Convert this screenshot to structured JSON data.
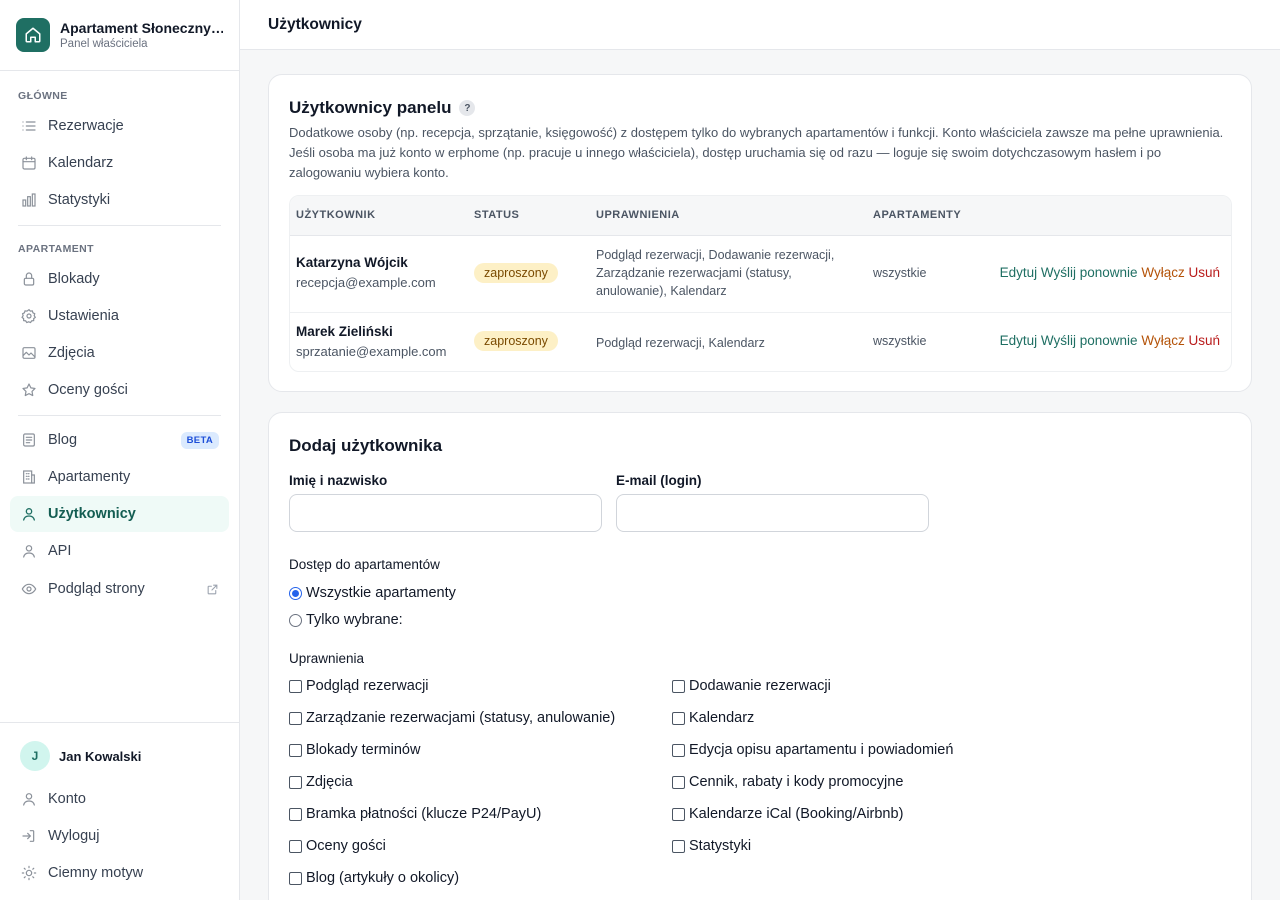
{
  "brand": {
    "title": "Apartament Słoneczny…",
    "subtitle": "Panel właściciela"
  },
  "sidebar": {
    "section_main": "GŁÓWNE",
    "section_apartment": "APARTAMENT",
    "items": [
      {
        "label": "Rezerwacje",
        "icon": "list-icon"
      },
      {
        "label": "Kalendarz",
        "icon": "calendar-icon"
      },
      {
        "label": "Statystyki",
        "icon": "bar-chart-icon"
      },
      {
        "label": "Blokady",
        "icon": "lock-icon"
      },
      {
        "label": "Ustawienia",
        "icon": "gear-icon"
      },
      {
        "label": "Zdjęcia",
        "icon": "image-icon"
      },
      {
        "label": "Oceny gości",
        "icon": "star-icon"
      },
      {
        "label": "Blog",
        "icon": "document-icon",
        "badge": "BETA"
      },
      {
        "label": "Apartamenty",
        "icon": "building-icon"
      },
      {
        "label": "Użytkownicy",
        "icon": "user-icon",
        "active": true
      },
      {
        "label": "API",
        "icon": "user-icon"
      },
      {
        "label": "Podgląd strony",
        "icon": "eye-icon"
      }
    ],
    "user": {
      "initial": "J",
      "name": "Jan Kowalski"
    },
    "bottom_items": [
      {
        "label": "Konto",
        "icon": "user-icon"
      },
      {
        "label": "Wyloguj",
        "icon": "logout-icon"
      },
      {
        "label": "Ciemny motyw",
        "icon": "sun-icon"
      }
    ]
  },
  "header": {
    "title": "Użytkownicy"
  },
  "panel_users": {
    "title": "Użytkownicy panelu",
    "help": "?",
    "description": "Dodatkowe osoby (np. recepcja, sprzątanie, księgowość) z dostępem tylko do wybranych apartamentów i funkcji. Konto właściciela zawsze ma pełne uprawnienia. Jeśli osoba ma już konto w erphome (np. pracuje u innego właściciela), dostęp uruchamia się od razu — loguje się swoim dotychczasowym hasłem i po zalogowaniu wybiera konto.",
    "columns": [
      "UŻYTKOWNIK",
      "STATUS",
      "UPRAWNIENIA",
      "APARTAMENTY"
    ],
    "rows": [
      {
        "name": "Katarzyna Wójcik",
        "email": "recepcja@example.com",
        "status": "zaproszony",
        "permissions": "Podgląd rezerwacji, Dodawanie rezerwacji, Zarządzanie rezerwacjami (statusy, anulowanie), Kalendarz",
        "apartments": "wszystkie"
      },
      {
        "name": "Marek Zieliński",
        "email": "sprzatanie@example.com",
        "status": "zaproszony",
        "permissions": "Podgląd rezerwacji, Kalendarz",
        "apartments": "wszystkie"
      }
    ],
    "actions": {
      "edit": "Edytuj",
      "resend": "Wyślij ponownie",
      "disable": "Wyłącz",
      "delete": "Usuń"
    }
  },
  "add_user": {
    "title": "Dodaj użytkownika",
    "name_label": "Imię i nazwisko",
    "name_value": "",
    "email_label": "E-mail (login)",
    "email_value": "",
    "access_label": "Dostęp do apartamentów",
    "access_options": [
      {
        "label": "Wszystkie apartamenty",
        "selected": true
      },
      {
        "label": "Tylko wybrane:",
        "selected": false
      }
    ],
    "permissions_label": "Uprawnienia",
    "permissions_left": [
      "Podgląd rezerwacji",
      "Zarządzanie rezerwacjami (statusy, anulowanie)",
      "Blokady terminów",
      "Zdjęcia",
      "Bramka płatności (klucze P24/PayU)",
      "Oceny gości",
      "Blog (artykuły o okolicy)"
    ],
    "permissions_right": [
      "Dodawanie rezerwacji",
      "Kalendarz",
      "Edycja opisu apartamentu i powiadomień",
      "Cennik, rabaty i kody promocyjne",
      "Kalendarze iCal (Booking/Airbnb)",
      "Statystyki"
    ]
  }
}
